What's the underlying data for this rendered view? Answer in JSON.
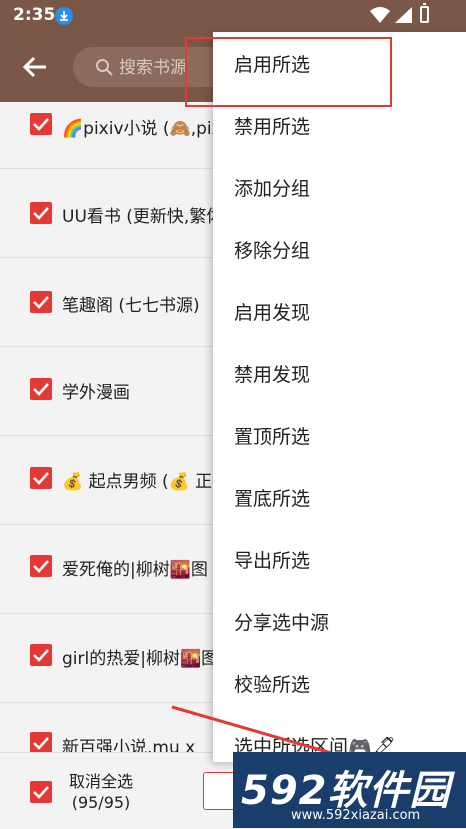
{
  "status_bar": {
    "time": "2:35"
  },
  "app_bar": {
    "search_placeholder": "搜索书源"
  },
  "list": [
    {
      "label": "🌈pixiv小说 (🙈,pix"
    },
    {
      "label": "UU看书 (更新快,繁体"
    },
    {
      "label": "笔趣阁 (七七书源)"
    },
    {
      "label": "学外漫画"
    },
    {
      "label": "💰 起点男频 (💰 正"
    },
    {
      "label": "爱死俺的|柳树🌇图"
    },
    {
      "label": "girl的热爱|柳树🌇图"
    },
    {
      "label": "新百强小说.mu x"
    }
  ],
  "bottom_bar": {
    "select_label": "取消全选",
    "select_count": "(95/95)"
  },
  "menu": [
    {
      "label": "启用所选"
    },
    {
      "label": "禁用所选"
    },
    {
      "label": "添加分组"
    },
    {
      "label": "移除分组"
    },
    {
      "label": "启用发现"
    },
    {
      "label": "禁用发现"
    },
    {
      "label": "置顶所选"
    },
    {
      "label": "置底所选"
    },
    {
      "label": "导出所选"
    },
    {
      "label": "分享选中源"
    },
    {
      "label": "校验所选"
    },
    {
      "label": "选中所选区间🎮🖊"
    }
  ],
  "watermark": {
    "logo": "592软件园",
    "url": "www.592xiazai.com"
  },
  "colors": {
    "primary": "#7b5747",
    "accent": "#e53935",
    "watermark_bg": "#1a3e6b"
  }
}
